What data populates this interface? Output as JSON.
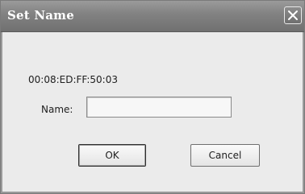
{
  "window": {
    "title": "Set Name",
    "close_icon": "close-icon"
  },
  "dialog": {
    "mac_address": "00:08:ED:FF:50:03",
    "name_label": "Name:",
    "name_value": "",
    "name_placeholder": ""
  },
  "buttons": {
    "ok_label": "OK",
    "cancel_label": "Cancel"
  },
  "colors": {
    "titlebar": "#838383",
    "background": "#ebebeb",
    "title_text": "#ffffff"
  }
}
